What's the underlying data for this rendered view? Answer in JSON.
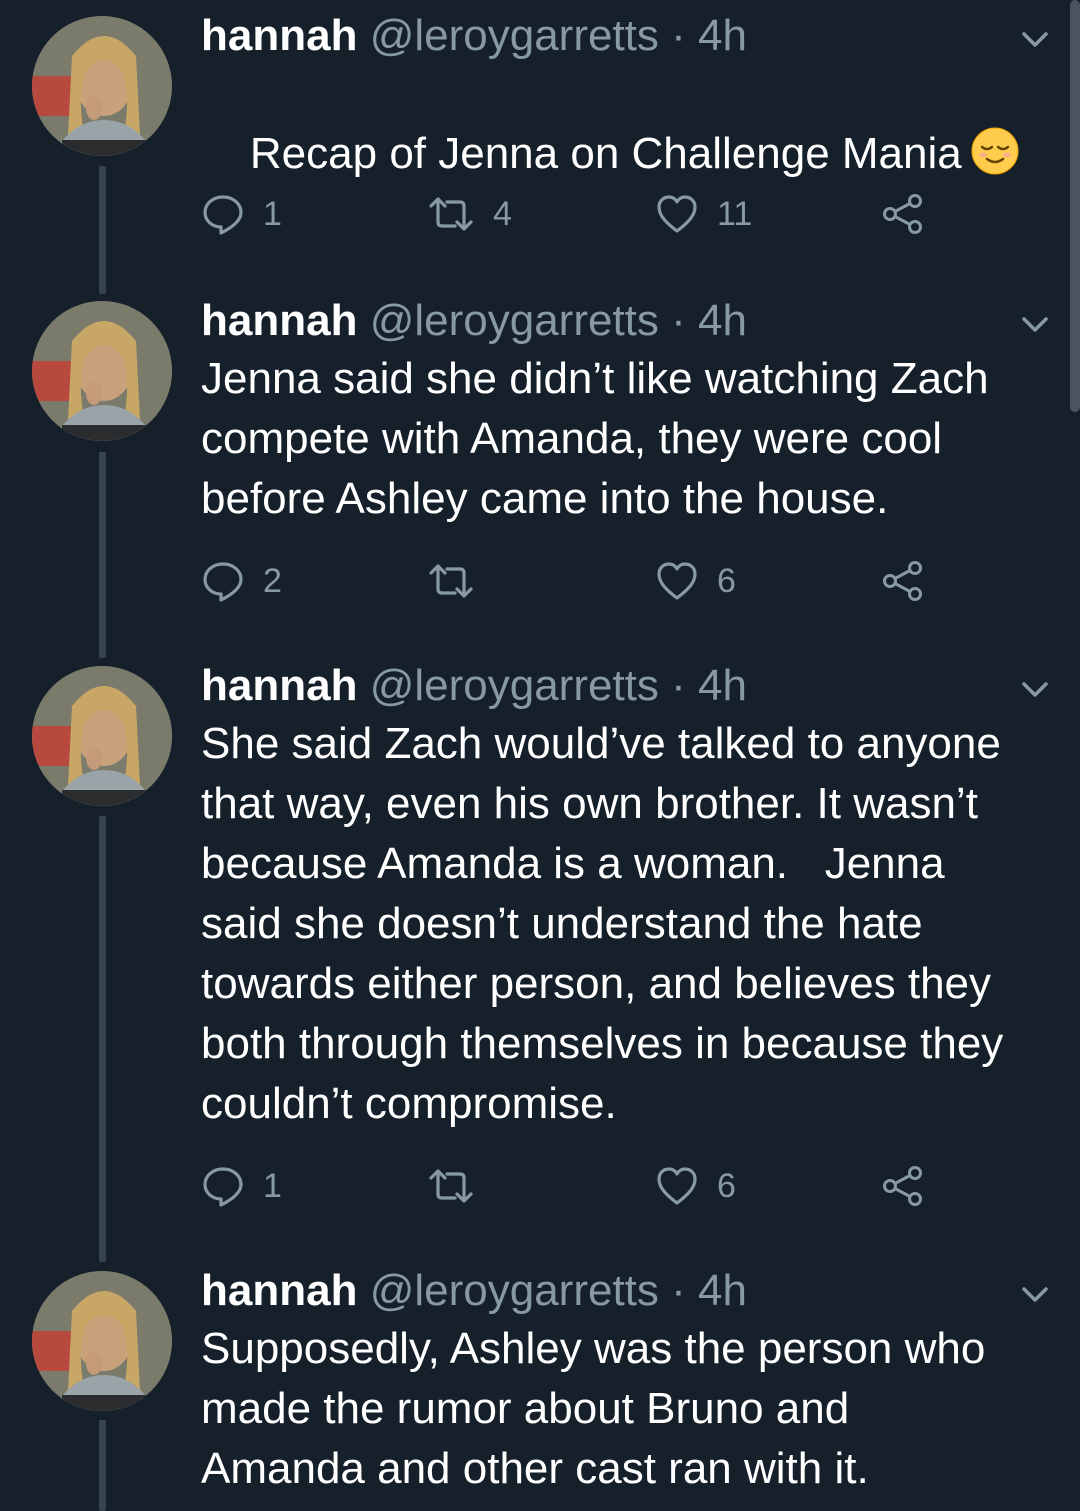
{
  "tweets": [
    {
      "name": "hannah",
      "handle": "@leroygarretts",
      "separator": "·",
      "time": "4h",
      "text": "Recap of Jenna on Challenge Mania",
      "emoji": "relieved-face",
      "replies": "1",
      "retweets": "4",
      "likes": "11"
    },
    {
      "name": "hannah",
      "handle": "@leroygarretts",
      "separator": "·",
      "time": "4h",
      "text": "Jenna said she didn’t like watching Zach\ncompete with Amanda, they were cool\nbefore Ashley came into the house.",
      "replies": "2",
      "retweets": "",
      "likes": "6"
    },
    {
      "name": "hannah",
      "handle": "@leroygarretts",
      "separator": "·",
      "time": "4h",
      "text": "She said Zach would’ve talked to anyone\nthat way, even his own brother. It wasn’t\nbecause Amanda is a woman.   Jenna\nsaid she doesn’t understand the hate\ntowards either person, and believes they\nboth through themselves in because they\ncouldn’t compromise.",
      "replies": "1",
      "retweets": "",
      "likes": "6"
    },
    {
      "name": "hannah",
      "handle": "@leroygarretts",
      "separator": "·",
      "time": "4h",
      "text": "Supposedly, Ashley was the person who\nmade the rumor about Bruno and\nAmanda and other cast ran with it."
    }
  ],
  "icons": {
    "reply": "reply-bubble-icon",
    "retweet": "retweet-icon",
    "like": "heart-icon",
    "share": "share-icon",
    "menu": "chevron-down-icon"
  },
  "colors": {
    "background": "#15202b",
    "text": "#ffffff",
    "secondary": "#8899a6",
    "thread_line": "#38444d"
  }
}
